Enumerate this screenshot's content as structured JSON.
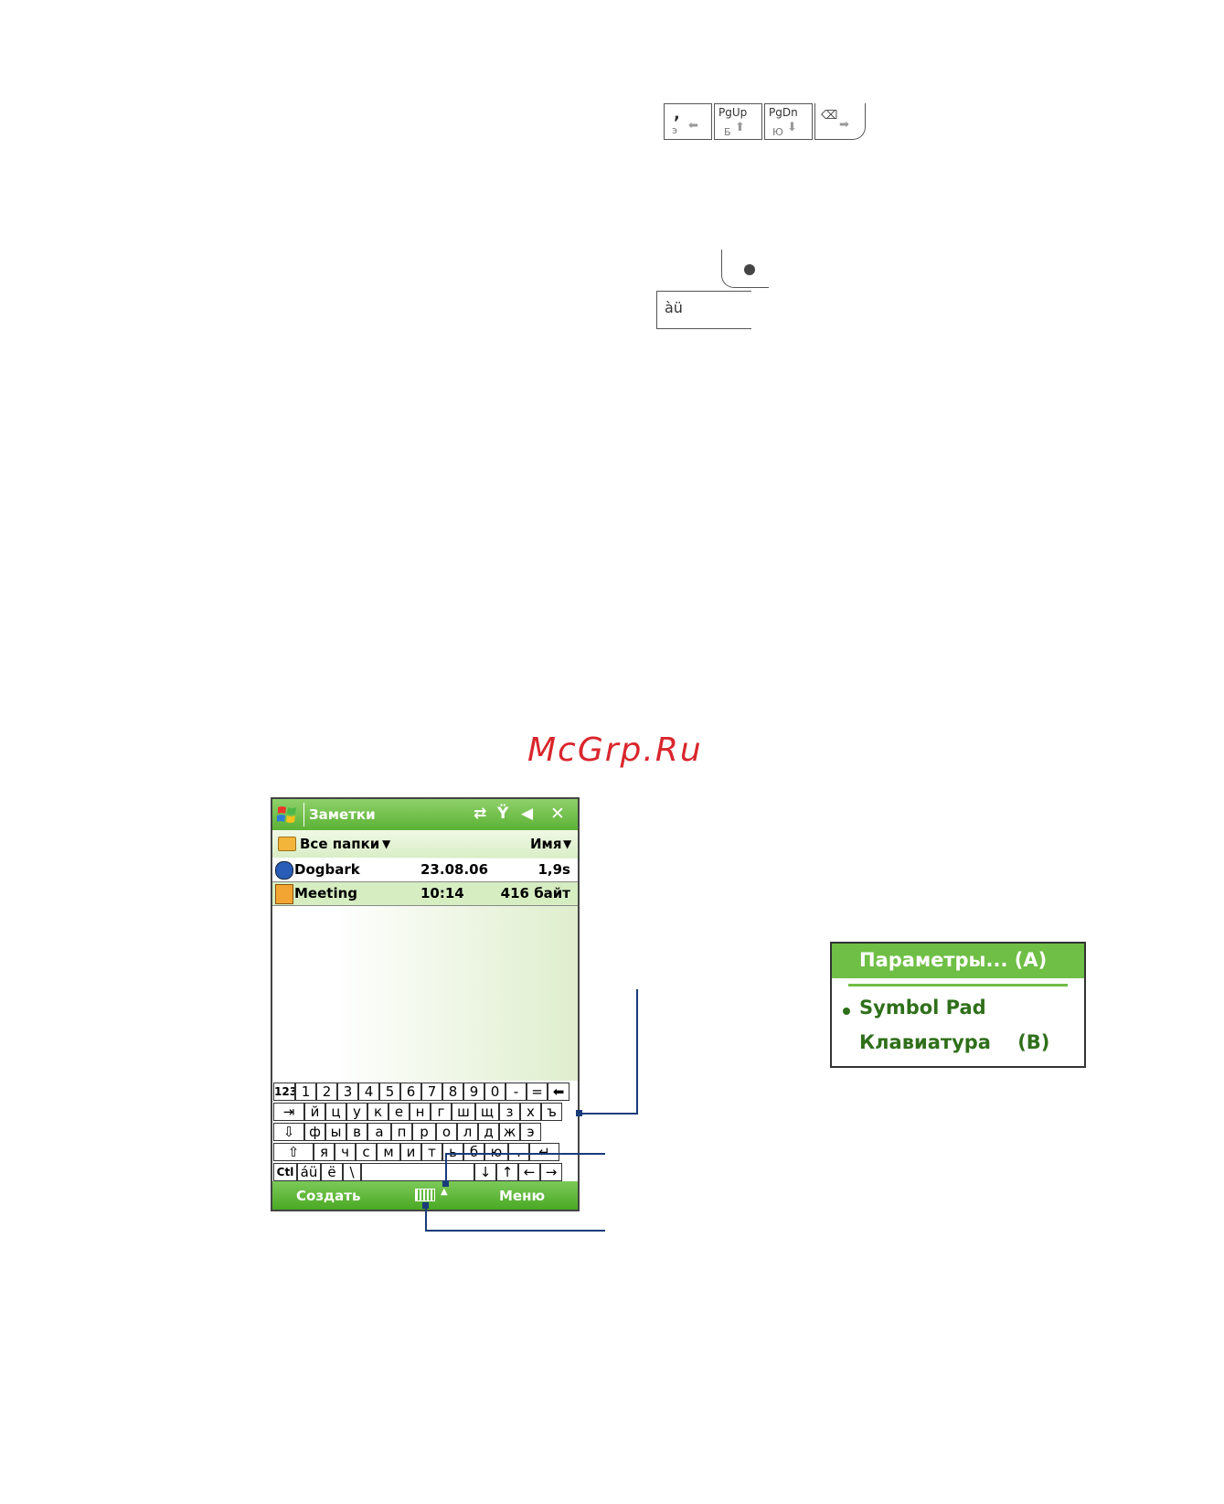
{
  "top_keys": {
    "comma_key": {
      "main": ",",
      "sub": "э"
    },
    "pgup_key": {
      "main": "PgUp",
      "sub": "Б"
    },
    "pgdn_key": {
      "main": "PgDn",
      "sub": "Ю"
    },
    "accent_key": {
      "main": "àü"
    }
  },
  "watermark": "McGrp.Ru",
  "device": {
    "title": "Заметки",
    "folder_label": "Все папки",
    "sort_label": "Имя",
    "files": [
      {
        "name": "Dogbark",
        "date": "23.08.06",
        "size": "1,9s"
      },
      {
        "name": "Meeting",
        "date": "10:14",
        "size": "416 байт"
      }
    ],
    "keyboard": {
      "row1": [
        "123",
        "1",
        "2",
        "3",
        "4",
        "5",
        "6",
        "7",
        "8",
        "9",
        "0",
        "-",
        "=",
        "⬅"
      ],
      "row2": [
        "⇥",
        "й",
        "ц",
        "у",
        "к",
        "е",
        "н",
        "г",
        "ш",
        "щ",
        "з",
        "х",
        "ъ"
      ],
      "row3": [
        "⇩",
        "ф",
        "ы",
        "в",
        "а",
        "п",
        "р",
        "о",
        "л",
        "д",
        "ж",
        "э"
      ],
      "row4": [
        "⇧",
        "я",
        "ч",
        "с",
        "м",
        "и",
        "т",
        "ь",
        "б",
        "ю",
        ".",
        "↵"
      ],
      "row5": [
        "Ctl",
        "áü",
        "ё",
        "\\",
        "",
        "↓",
        "↑",
        "←",
        "→"
      ]
    },
    "menu_left": "Создать",
    "menu_right": "Меню"
  },
  "popup": {
    "options": "Параметры... (A)",
    "symbol_pad": "Symbol Pad",
    "keyboard": "Клавиатура    (B)"
  }
}
